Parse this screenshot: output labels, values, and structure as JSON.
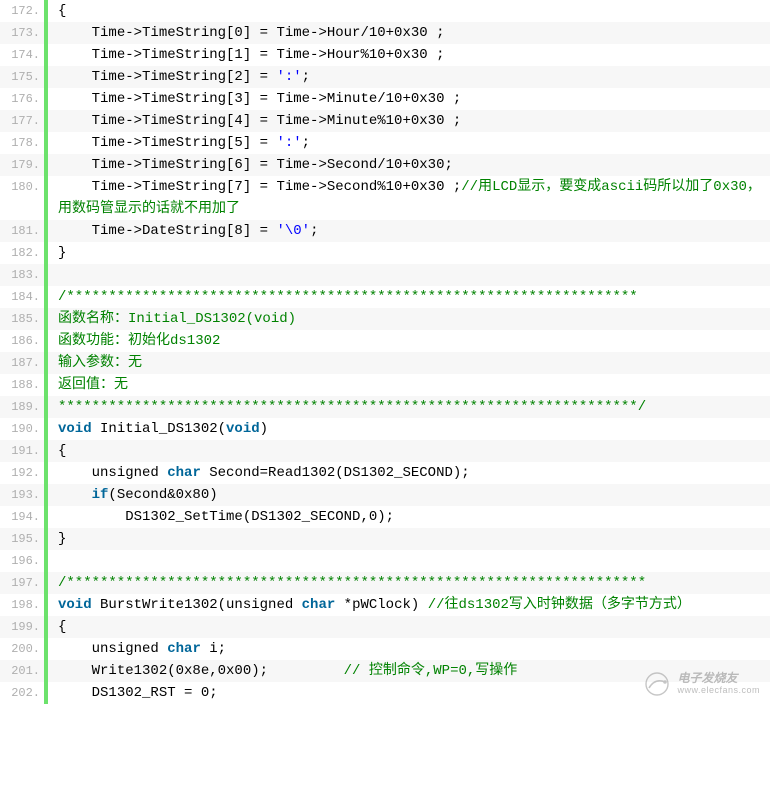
{
  "watermark": {
    "title": "电子发烧友",
    "url": "www.elecfans.com"
  },
  "lines": [
    {
      "n": "172.",
      "tokens": [
        {
          "cls": "plain",
          "t": "{"
        }
      ]
    },
    {
      "n": "173.",
      "tokens": [
        {
          "cls": "plain",
          "t": "    Time->TimeString[0] = Time->Hour/10+0x30 ;"
        }
      ]
    },
    {
      "n": "174.",
      "tokens": [
        {
          "cls": "plain",
          "t": "    Time->TimeString[1] = Time->Hour%10+0x30 ;"
        }
      ]
    },
    {
      "n": "175.",
      "tokens": [
        {
          "cls": "plain",
          "t": "    Time->TimeString[2] = "
        },
        {
          "cls": "str",
          "t": "':'"
        },
        {
          "cls": "plain",
          "t": ";"
        }
      ]
    },
    {
      "n": "176.",
      "tokens": [
        {
          "cls": "plain",
          "t": "    Time->TimeString[3] = Time->Minute/10+0x30 ;"
        }
      ]
    },
    {
      "n": "177.",
      "tokens": [
        {
          "cls": "plain",
          "t": "    Time->TimeString[4] = Time->Minute%10+0x30 ;"
        }
      ]
    },
    {
      "n": "178.",
      "tokens": [
        {
          "cls": "plain",
          "t": "    Time->TimeString[5] = "
        },
        {
          "cls": "str",
          "t": "':'"
        },
        {
          "cls": "plain",
          "t": ";"
        }
      ]
    },
    {
      "n": "179.",
      "tokens": [
        {
          "cls": "plain",
          "t": "    Time->TimeString[6] = Time->Second/10+0x30;"
        }
      ]
    },
    {
      "n": "180.",
      "tokens": [
        {
          "cls": "plain",
          "t": "    Time->TimeString[7] = Time->Second%10+0x30 ;"
        },
        {
          "cls": "comment",
          "t": "//用LCD显示，要变成ascii码所以加了0x30，用数码管显示的话就不用加了"
        }
      ]
    },
    {
      "n": "181.",
      "tokens": [
        {
          "cls": "plain",
          "t": "    Time->DateString[8] = "
        },
        {
          "cls": "str",
          "t": "'\\0'"
        },
        {
          "cls": "plain",
          "t": ";"
        }
      ]
    },
    {
      "n": "182.",
      "tokens": [
        {
          "cls": "plain",
          "t": "}"
        }
      ]
    },
    {
      "n": "183.",
      "tokens": [
        {
          "cls": "plain",
          "t": ""
        }
      ]
    },
    {
      "n": "184.",
      "tokens": [
        {
          "cls": "comment",
          "t": "/********************************************************************"
        }
      ]
    },
    {
      "n": "185.",
      "tokens": [
        {
          "cls": "comment",
          "t": "函数名称：Initial_DS1302(void)"
        }
      ]
    },
    {
      "n": "186.",
      "tokens": [
        {
          "cls": "comment",
          "t": "函数功能：初始化ds1302"
        }
      ]
    },
    {
      "n": "187.",
      "tokens": [
        {
          "cls": "comment",
          "t": "输入参数：无"
        }
      ]
    },
    {
      "n": "188.",
      "tokens": [
        {
          "cls": "comment",
          "t": "返回值：无"
        }
      ]
    },
    {
      "n": "189.",
      "tokens": [
        {
          "cls": "comment",
          "t": "*********************************************************************/"
        }
      ]
    },
    {
      "n": "190.",
      "tokens": [
        {
          "cls": "kw",
          "t": "void"
        },
        {
          "cls": "plain",
          "t": " Initial_DS1302("
        },
        {
          "cls": "kw",
          "t": "void"
        },
        {
          "cls": "plain",
          "t": ")"
        }
      ]
    },
    {
      "n": "191.",
      "tokens": [
        {
          "cls": "plain",
          "t": "{"
        }
      ]
    },
    {
      "n": "192.",
      "tokens": [
        {
          "cls": "plain",
          "t": "    unsigned "
        },
        {
          "cls": "kw",
          "t": "char"
        },
        {
          "cls": "plain",
          "t": " Second=Read1302(DS1302_SECOND);"
        }
      ]
    },
    {
      "n": "193.",
      "tokens": [
        {
          "cls": "plain",
          "t": "    "
        },
        {
          "cls": "kw",
          "t": "if"
        },
        {
          "cls": "plain",
          "t": "(Second&0x80)"
        }
      ]
    },
    {
      "n": "194.",
      "tokens": [
        {
          "cls": "plain",
          "t": "        DS1302_SetTime(DS1302_SECOND,0);"
        }
      ]
    },
    {
      "n": "195.",
      "tokens": [
        {
          "cls": "plain",
          "t": "}"
        }
      ]
    },
    {
      "n": "196.",
      "tokens": [
        {
          "cls": "plain",
          "t": ""
        }
      ]
    },
    {
      "n": "197.",
      "tokens": [
        {
          "cls": "comment",
          "t": "/*********************************************************************"
        }
      ]
    },
    {
      "n": "198.",
      "tokens": [
        {
          "cls": "kw",
          "t": "void"
        },
        {
          "cls": "plain",
          "t": " BurstWrite1302(unsigned "
        },
        {
          "cls": "kw",
          "t": "char"
        },
        {
          "cls": "plain",
          "t": " *pWClock) "
        },
        {
          "cls": "comment",
          "t": "//往ds1302写入时钟数据（多字节方式）"
        }
      ]
    },
    {
      "n": "199.",
      "tokens": [
        {
          "cls": "plain",
          "t": "{"
        }
      ]
    },
    {
      "n": "200.",
      "tokens": [
        {
          "cls": "plain",
          "t": "    unsigned "
        },
        {
          "cls": "kw",
          "t": "char"
        },
        {
          "cls": "plain",
          "t": " i;"
        }
      ]
    },
    {
      "n": "201.",
      "tokens": [
        {
          "cls": "plain",
          "t": "    Write1302(0x8e,0x00);         "
        },
        {
          "cls": "comment",
          "t": "// 控制命令,WP=0,写操作"
        }
      ]
    },
    {
      "n": "202.",
      "tokens": [
        {
          "cls": "plain",
          "t": "    DS1302_RST = 0;"
        }
      ]
    }
  ]
}
